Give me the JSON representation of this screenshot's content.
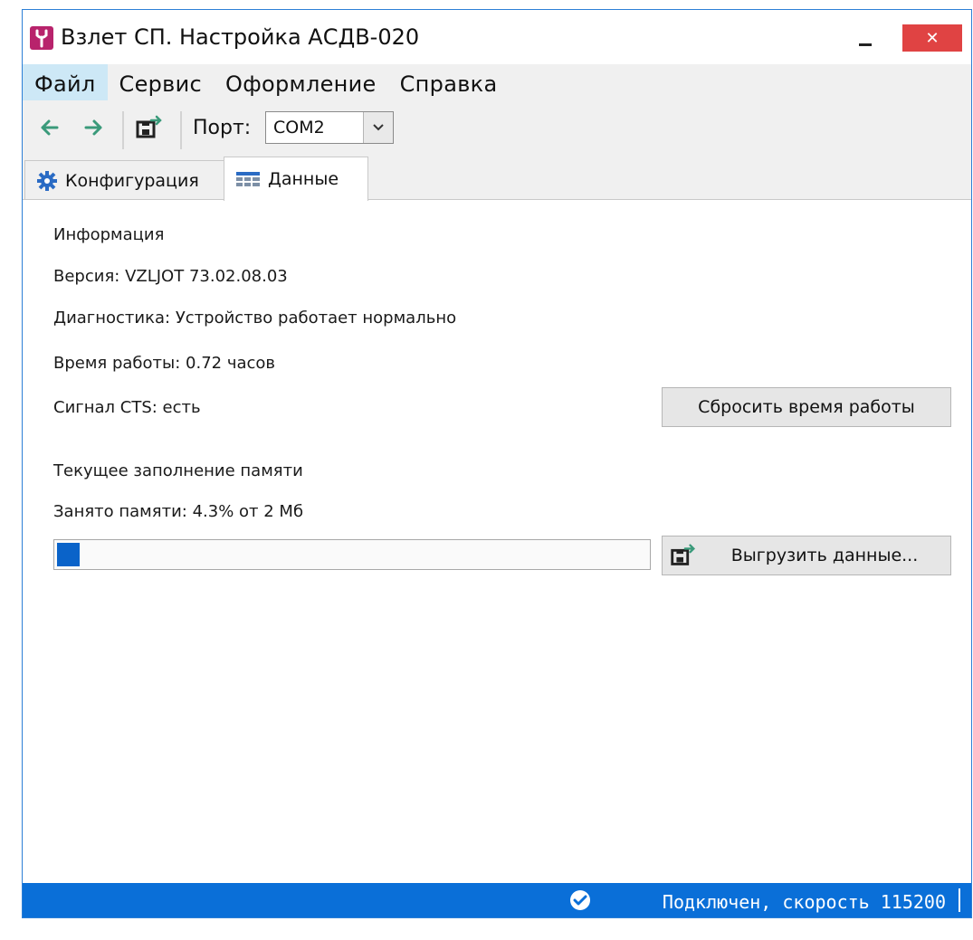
{
  "window": {
    "title": "Взлет СП. Настройка АСДВ-020",
    "close_label": "✕"
  },
  "menu": {
    "items": [
      {
        "label": "Файл",
        "active": true
      },
      {
        "label": "Сервис"
      },
      {
        "label": "Оформление"
      },
      {
        "label": "Справка"
      }
    ]
  },
  "toolbar": {
    "port_label": "Порт:",
    "port_value": "COM2"
  },
  "tabs": [
    {
      "label": "Конфигурация",
      "icon": "gear-icon",
      "active": false
    },
    {
      "label": "Данные",
      "icon": "table-icon",
      "active": true
    }
  ],
  "info": {
    "section_title": "Информация",
    "version_label": "Версия:",
    "version_value": "VZLJOT 73.02.08.03",
    "diagnostics_label": "Диагностика:",
    "diagnostics_value": "Устройство работает нормально",
    "uptime_label": "Время работы:",
    "uptime_value": "0.72 часов",
    "cts_label": "Сигнал CTS:",
    "cts_value": "есть",
    "reset_button": "Сбросить время работы"
  },
  "memory": {
    "section_title": "Текущее заполнение памяти",
    "used_text": "Занято памяти: 4.3% от 2 Мб",
    "percent_used": 4.3,
    "export_button": "Выгрузить данные..."
  },
  "status": {
    "text": "Подключен, скорость 115200",
    "icon": "check-circle-icon"
  },
  "colors": {
    "accent": "#0a6fd8",
    "progress": "#0a63c9",
    "app_icon": "#b8236c",
    "close": "#e04343",
    "arrow_green": "#3a9a7a"
  }
}
